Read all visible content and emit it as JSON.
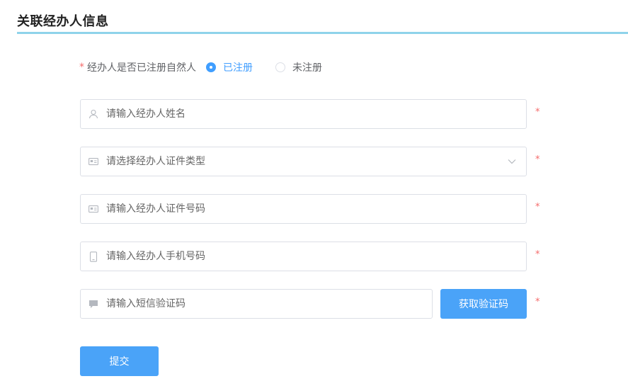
{
  "section": {
    "title": "关联经办人信息"
  },
  "registration": {
    "required_mark": "*",
    "question": "经办人是否已注册自然人",
    "options": [
      {
        "label": "已注册",
        "checked": true
      },
      {
        "label": "未注册",
        "checked": false
      }
    ]
  },
  "form": {
    "name": {
      "placeholder": "请输入经办人姓名",
      "icon": "user-icon",
      "required_mark": "*"
    },
    "id_type": {
      "placeholder": "请选择经办人证件类型",
      "icon": "id-card-icon",
      "required_mark": "*"
    },
    "id_number": {
      "placeholder": "请输入经办人证件号码",
      "icon": "id-card-icon",
      "required_mark": "*"
    },
    "phone": {
      "placeholder": "请输入经办人手机号码",
      "icon": "phone-icon",
      "required_mark": "*"
    },
    "sms_code": {
      "placeholder": "请输入短信验证码",
      "icon": "message-icon",
      "required_mark": "*"
    }
  },
  "buttons": {
    "get_code": "获取验证码",
    "submit": "提交"
  },
  "colors": {
    "accent": "#409eff",
    "button": "#4aa3f8",
    "required": "#f56c6c",
    "title_underline": "#8fd3ea"
  }
}
